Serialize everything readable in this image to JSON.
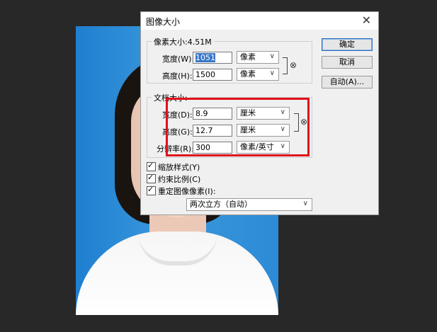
{
  "dialog": {
    "title": "图像大小",
    "close_glyph": "✕",
    "pixel_dimensions": {
      "label": "像素大小:4.51M",
      "width_label": "宽度(W):",
      "width_value": "1051",
      "width_unit": "像素",
      "height_label": "高度(H):",
      "height_value": "1500",
      "height_unit": "像素"
    },
    "document_size": {
      "label": "文档大小:",
      "width_label": "宽度(D):",
      "width_value": "8.9",
      "width_unit": "厘米",
      "height_label": "高度(G):",
      "height_value": "12.7",
      "height_unit": "厘米",
      "resolution_label": "分辨率(R):",
      "resolution_value": "300",
      "resolution_unit": "像素/英寸"
    },
    "options": {
      "scale_styles": "缩放样式(Y)",
      "constrain_proportions": "约束比例(C)",
      "resample": "重定图像像素(I):",
      "resample_method": "两次立方（自动）"
    },
    "buttons": {
      "ok": "确定",
      "cancel": "取消",
      "auto": "自动(A)..."
    },
    "dropdown_arrow": "∨",
    "link_icon": "⊗"
  },
  "colors": {
    "highlight_box": "#e0101c",
    "canvas_bg": "#282828",
    "photo_bg": "#2d8ad6"
  }
}
